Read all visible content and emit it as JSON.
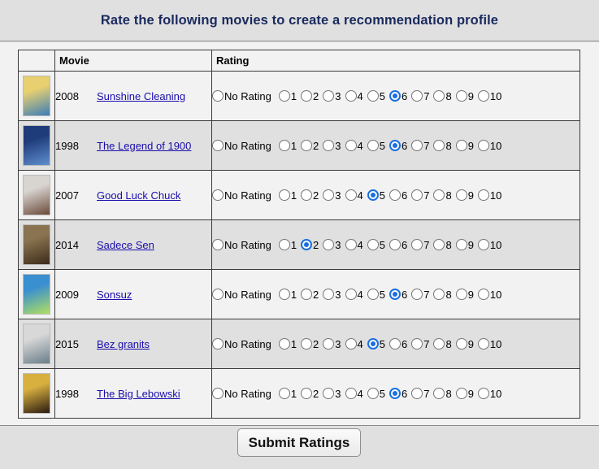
{
  "page": {
    "heading": "Rate the following movies to create a recommendation profile"
  },
  "table": {
    "columns": [
      "",
      "Movie",
      "Rating"
    ],
    "rating_options": [
      "No Rating",
      "1",
      "2",
      "3",
      "4",
      "5",
      "6",
      "7",
      "8",
      "9",
      "10"
    ],
    "rows": [
      {
        "year": "2008",
        "title": "Sunshine Cleaning",
        "selected": "6",
        "poster_colors": [
          "#e8d070",
          "#3a7db8"
        ]
      },
      {
        "year": "1998",
        "title": "The Legend of 1900",
        "selected": "6",
        "poster_colors": [
          "#1f3c7a",
          "#5f8fcf"
        ]
      },
      {
        "year": "2007",
        "title": "Good Luck Chuck",
        "selected": "5",
        "poster_colors": [
          "#d8d4d0",
          "#6b4a3a"
        ]
      },
      {
        "year": "2014",
        "title": "Sadece Sen",
        "selected": "2",
        "poster_colors": [
          "#8a7350",
          "#3d2b1b"
        ]
      },
      {
        "year": "2009",
        "title": "Sonsuz",
        "selected": "6",
        "poster_colors": [
          "#3a8fd0",
          "#b0e060"
        ]
      },
      {
        "year": "2015",
        "title": "Bez granits",
        "selected": "5",
        "poster_colors": [
          "#d8d8d8",
          "#6a7e8a"
        ]
      },
      {
        "year": "1998",
        "title": "The Big Lebowski",
        "selected": "6",
        "poster_colors": [
          "#d8b040",
          "#2a1a10"
        ]
      }
    ]
  },
  "footer": {
    "submit_label": "Submit Ratings"
  },
  "colors": {
    "heading": "#1a2a5e",
    "link": "#1a0dab",
    "radio_selected": "#1a6fe0",
    "row_light": "#f2f2f2",
    "row_dark": "#e0e0e0"
  }
}
